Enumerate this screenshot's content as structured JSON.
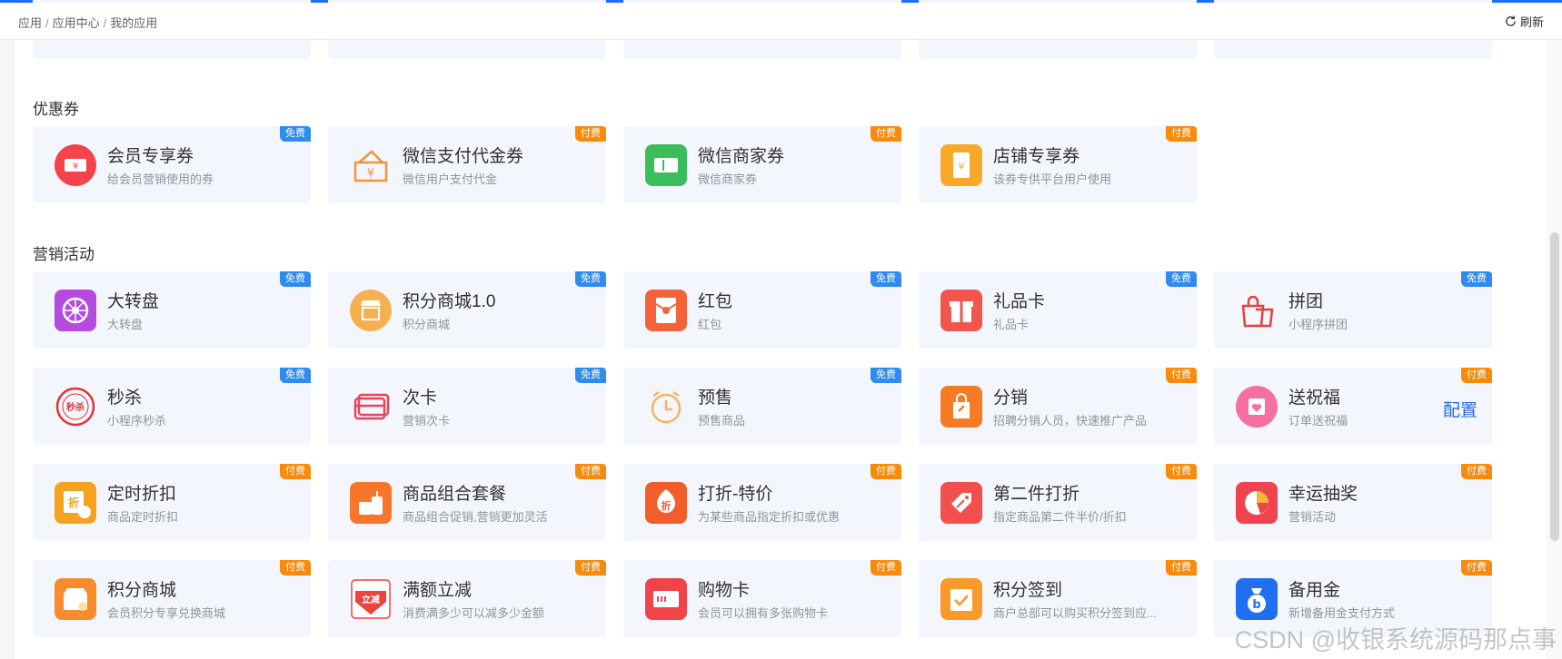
{
  "breadcrumb": [
    "应用",
    "应用中心",
    "我的应用"
  ],
  "refresh_label": "刷新",
  "sections": [
    {
      "title": "优惠券",
      "cards": [
        {
          "name": "会员专享券",
          "desc": "给会员营销使用的券",
          "badge": "免费",
          "badge_type": "free",
          "icon": "ticket-icon",
          "color": "#f2444a"
        },
        {
          "name": "微信支付代金券",
          "desc": "微信用户支付代金",
          "badge": "付费",
          "badge_type": "paid",
          "icon": "wallet-icon",
          "color": "#f7923a"
        },
        {
          "name": "微信商家券",
          "desc": "微信商家券",
          "badge": "付费",
          "badge_type": "paid",
          "icon": "merchant-coupon-icon",
          "color": "#3cbd5c"
        },
        {
          "name": "店铺专享券",
          "desc": "该券专供平台用户使用",
          "badge": "付费",
          "badge_type": "paid",
          "icon": "shop-coupon-icon",
          "color": "#f9a92a"
        }
      ]
    },
    {
      "title": "营销活动",
      "cards": [
        {
          "name": "大转盘",
          "desc": "大转盘",
          "badge": "免费",
          "badge_type": "free",
          "icon": "wheel-icon",
          "color": "#b44ae0"
        },
        {
          "name": "积分商城1.0",
          "desc": "积分商城",
          "badge": "免费",
          "badge_type": "free",
          "icon": "store-icon",
          "color": "#f5b151"
        },
        {
          "name": "红包",
          "desc": "红包",
          "badge": "免费",
          "badge_type": "free",
          "icon": "red-packet-icon",
          "color": "#f3633a"
        },
        {
          "name": "礼品卡",
          "desc": "礼品卡",
          "badge": "免费",
          "badge_type": "free",
          "icon": "gift-card-icon",
          "color": "#f2544e"
        },
        {
          "name": "拼团",
          "desc": "小程序拼团",
          "badge": "免费",
          "badge_type": "free",
          "icon": "group-buy-icon",
          "color": "#e8403e"
        },
        {
          "name": "秒杀",
          "desc": "小程序秒杀",
          "badge": "免费",
          "badge_type": "free",
          "icon": "flash-sale-icon",
          "color": "#e03434"
        },
        {
          "name": "次卡",
          "desc": "营销次卡",
          "badge": "免费",
          "badge_type": "free",
          "icon": "card-icon",
          "color": "#e8455a"
        },
        {
          "name": "预售",
          "desc": "预售商品",
          "badge": "免费",
          "badge_type": "free",
          "icon": "clock-icon",
          "color": "#f6b364"
        },
        {
          "name": "分销",
          "desc": "招聘分销人员，快速推广产品",
          "badge": "付费",
          "badge_type": "paid",
          "icon": "distribution-icon",
          "color": "#f67b24"
        },
        {
          "name": "送祝福",
          "desc": "订单送祝福",
          "badge": "付费",
          "badge_type": "paid",
          "icon": "blessing-icon",
          "color": "#f56fa0",
          "action": "配置"
        },
        {
          "name": "定时折扣",
          "desc": "商品定时折扣",
          "badge": "付费",
          "badge_type": "paid",
          "icon": "timed-discount-icon",
          "color": "#f7a21f"
        },
        {
          "name": "商品组合套餐",
          "desc": "商品组合促销,营销更加灵活",
          "badge": "付费",
          "badge_type": "paid",
          "icon": "combo-icon",
          "color": "#f6772c"
        },
        {
          "name": "打折-特价",
          "desc": "为某些商品指定折扣或优惠",
          "badge": "付费",
          "badge_type": "paid",
          "icon": "discount-icon",
          "color": "#f25d2b"
        },
        {
          "name": "第二件打折",
          "desc": "指定商品第二件半价/折扣",
          "badge": "付费",
          "badge_type": "paid",
          "icon": "second-item-icon",
          "color": "#f24f4f"
        },
        {
          "name": "幸运抽奖",
          "desc": "营销活动",
          "badge": "付费",
          "badge_type": "paid",
          "icon": "lottery-icon",
          "color": "#ef4450"
        },
        {
          "name": "积分商城",
          "desc": "会员积分专享兑换商城",
          "badge": "付费",
          "badge_type": "paid",
          "icon": "points-store-icon",
          "color": "#f88b2d"
        },
        {
          "name": "满额立减",
          "desc": "消费满多少可以减多少金额",
          "badge": "付费",
          "badge_type": "paid",
          "icon": "full-reduction-icon",
          "color": "#ef4040"
        },
        {
          "name": "购物卡",
          "desc": "会员可以拥有多张购物卡",
          "badge": "付费",
          "badge_type": "paid",
          "icon": "shopping-card-icon",
          "color": "#f0434a"
        },
        {
          "name": "积分签到",
          "desc": "商户总部可以购买积分签到应...",
          "badge": "付费",
          "badge_type": "paid",
          "icon": "check-in-icon",
          "color": "#f99a2a"
        },
        {
          "name": "备用金",
          "desc": "新增备用金支付方式",
          "badge": "付费",
          "badge_type": "paid",
          "icon": "money-bag-icon",
          "color": "#1f6ff0"
        }
      ]
    }
  ],
  "watermark": "CSDN @收银系统源码那点事"
}
